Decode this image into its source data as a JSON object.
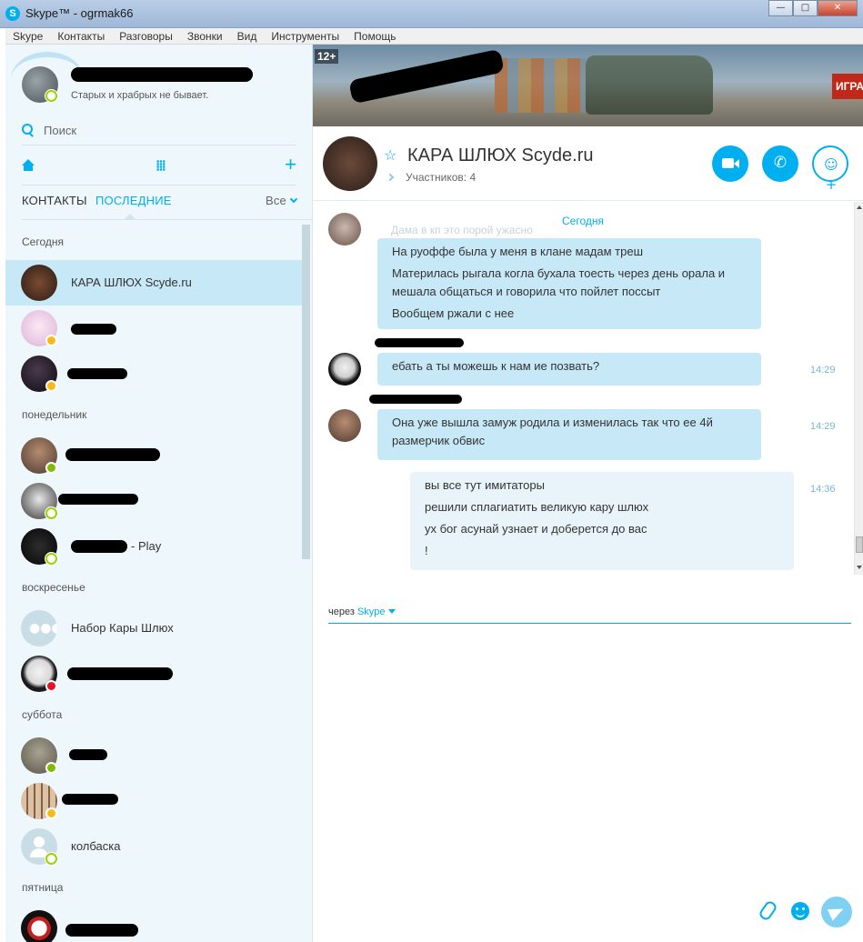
{
  "window": {
    "title": "Skype™ - ogrmak66",
    "app_icon": "skype-icon"
  },
  "menu": [
    "Skype",
    "Контакты",
    "Разговоры",
    "Звонки",
    "Вид",
    "Инструменты",
    "Помощь"
  ],
  "profile": {
    "mood": "Старых и храбрых не бывает.",
    "status": "online"
  },
  "search": {
    "placeholder": "Поиск"
  },
  "tabs": {
    "contacts": "КОНТАКТЫ",
    "recent": "ПОСЛЕДНИЕ",
    "filter": "Все"
  },
  "sections": [
    "Сегодня",
    "понедельник",
    "воскресенье",
    "суббота",
    "пятница"
  ],
  "contacts": [
    {
      "name": "КАРА ШЛЮХ Scyde.ru",
      "status": "none",
      "selected": true
    },
    {
      "name": "",
      "status": "away"
    },
    {
      "name": "",
      "status": "away"
    },
    {
      "name": "",
      "status": "online"
    },
    {
      "name": "",
      "status": "online-hollow"
    },
    {
      "name": "- Play",
      "status": "online-hollow"
    },
    {
      "name": "Набор Кары Шлюх",
      "status": "group"
    },
    {
      "name": "",
      "status": "busy"
    },
    {
      "name": "",
      "status": "online"
    },
    {
      "name": "",
      "status": "away"
    },
    {
      "name": "колбаска",
      "status": "online-hollow"
    },
    {
      "name": "",
      "status": "none"
    }
  ],
  "banner": {
    "age_rating": "12+",
    "cta": "ИГРА"
  },
  "conversation": {
    "title": "КАРА ШЛЮХ Scyde.ru",
    "participants": "Участников: 4",
    "date_divider": "Сегодня",
    "faded_preview": "Дама в кп это порой ужасно",
    "messages": [
      {
        "lines": [
          "На руоффе была у меня в клане мадам треш",
          "Материлась рыгала когла бухала тоесть через день орала и мешала общаться и говорила что пойлет поссыт",
          "Вообщем ржали с нее"
        ],
        "time": ""
      },
      {
        "lines": [
          "ебать а ты можешь к нам ие позвать?"
        ],
        "time": "14:29"
      },
      {
        "lines": [
          "Она уже вышла замуж родила и изменилась так что ее 4й размерчик обвис"
        ],
        "time": "14:29"
      },
      {
        "lines": [
          "вы все тут имитаторы",
          "решили сплагиатить великую кару шлюх",
          "ух бог асунай узнает и доберется до вас",
          "!"
        ],
        "time": "14:36"
      }
    ]
  },
  "compose": {
    "via_prefix": "через",
    "via_service": "Skype"
  },
  "colors": {
    "accent": "#00aff0",
    "bubble_in": "#c7e8f7",
    "bubble_out": "#e8f4fa",
    "selected_row": "#c7e8f7"
  }
}
